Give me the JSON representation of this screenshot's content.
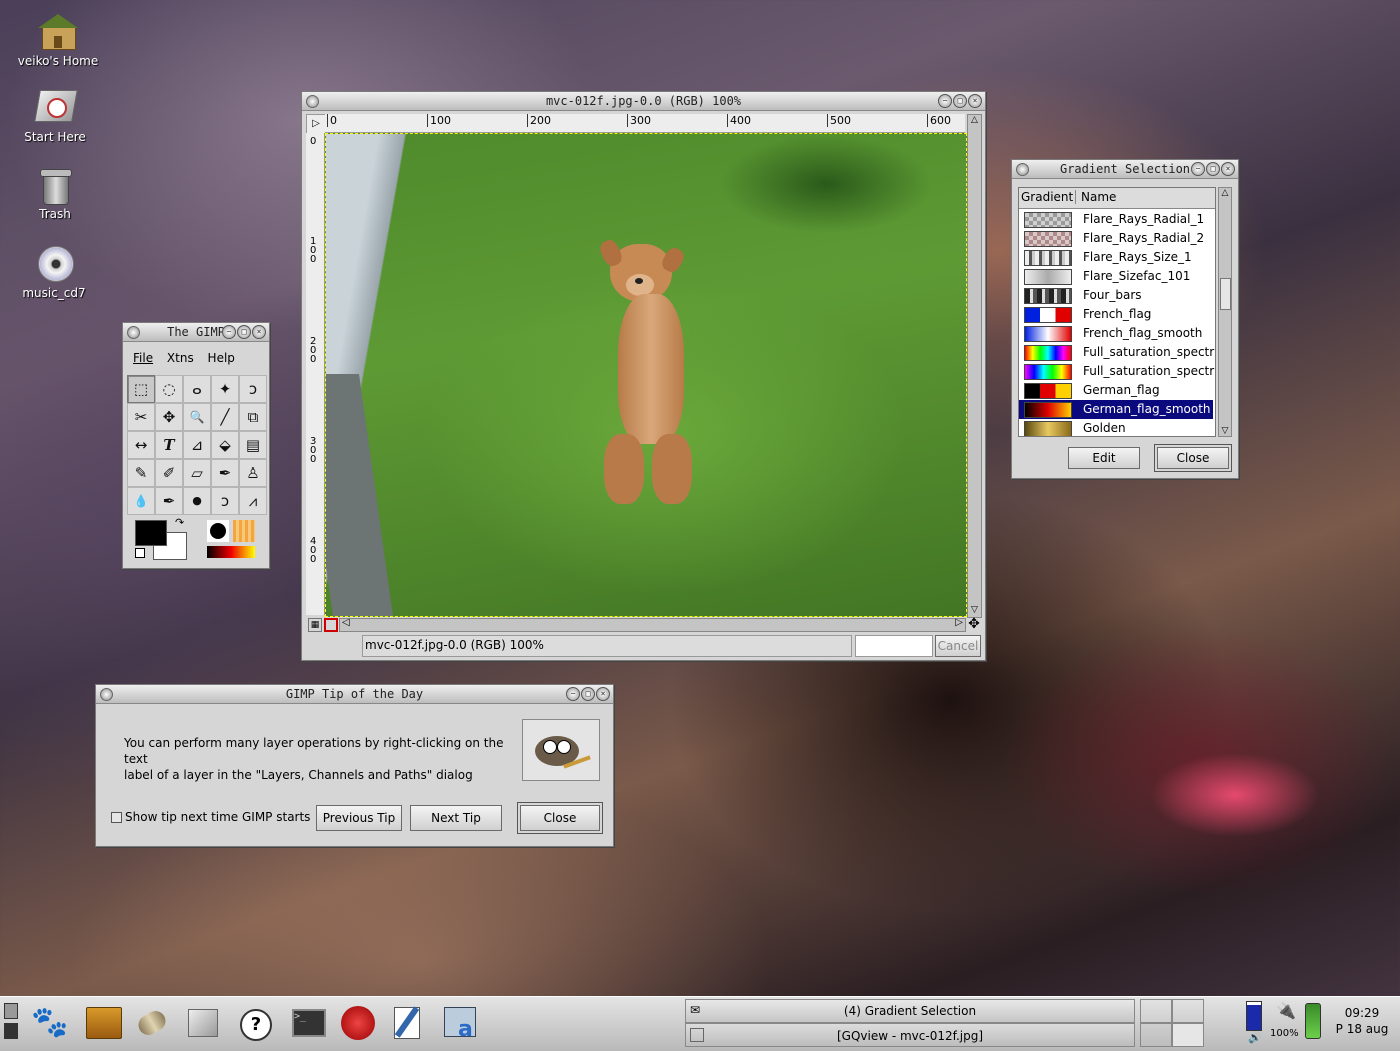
{
  "desktop": {
    "icons": [
      {
        "label": "veiko's Home",
        "icon": "home-icon"
      },
      {
        "label": "Start Here",
        "icon": "start-here-icon"
      },
      {
        "label": "Trash",
        "icon": "trash-icon"
      },
      {
        "label": "music_cd7",
        "icon": "cd-icon"
      }
    ]
  },
  "image_window": {
    "title": "mvc-012f.jpg-0.0 (RGB) 100%",
    "ruler_h": [
      "0",
      "100",
      "200",
      "300",
      "400",
      "500",
      "600"
    ],
    "ruler_v": [
      "0",
      "100",
      "200",
      "300",
      "400"
    ],
    "status": "mvc-012f.jpg-0.0 (RGB) 100%",
    "cancel_label": "Cancel"
  },
  "gimp_toolbox": {
    "title": "The GIMP",
    "menu": [
      "File",
      "Xtns",
      "Help"
    ],
    "tools": [
      "rect-select",
      "ellipse-select",
      "free-select",
      "fuzzy-select",
      "bezier-select",
      "intelligent-scissors",
      "move",
      "magnify",
      "crop",
      "transform",
      "flip",
      "text",
      "color-picker",
      "bucket-fill",
      "blend",
      "pencil",
      "paintbrush",
      "eraser",
      "airbrush",
      "clone",
      "convolve",
      "ink",
      "dodge-burn",
      "smudge",
      "measure"
    ],
    "tool_glyphs": [
      "⬚",
      "◌",
      "ⴰ",
      "✦",
      "ↄ",
      "✂",
      "✥",
      "🔍",
      "╱",
      "⧉",
      "↔",
      "T",
      "⊿",
      "⬙",
      "▤",
      "✎",
      "✐",
      "▱",
      "✒",
      "♙",
      "💧",
      "✒",
      "●",
      "ↄ",
      "⩘"
    ]
  },
  "gradient_selection": {
    "title": "Gradient Selection",
    "columns": [
      "Gradient",
      "Name"
    ],
    "items": [
      {
        "name": "Flare_Rays_Radial_1",
        "preview": "checker-grey"
      },
      {
        "name": "Flare_Rays_Radial_2",
        "preview": "checker-pink"
      },
      {
        "name": "Flare_Rays_Size_1",
        "preview": "stripes-grey"
      },
      {
        "name": "Flare_Sizefac_101",
        "preview": "grey-fade"
      },
      {
        "name": "Four_bars",
        "preview": "bars"
      },
      {
        "name": "French_flag",
        "preview": "french"
      },
      {
        "name": "French_flag_smooth",
        "preview": "french-smooth"
      },
      {
        "name": "Full_saturation_spectru",
        "preview": "spectrum"
      },
      {
        "name": "Full_saturation_spectru",
        "preview": "spectrum2"
      },
      {
        "name": "German_flag",
        "preview": "german"
      },
      {
        "name": "German_flag_smooth",
        "preview": "german-smooth"
      },
      {
        "name": "Golden",
        "preview": "golden"
      }
    ],
    "selected_index": 10,
    "edit_label": "Edit",
    "close_label": "Close"
  },
  "tip_dialog": {
    "title": "GIMP Tip of the Day",
    "tip_line1": "You can perform many layer operations by right-clicking on the text",
    "tip_line2": "label of a layer in the \"Layers, Channels and Paths\" dialog",
    "checkbox_label": "Show tip next time GIMP starts",
    "checkbox_checked": false,
    "previous_label": "Previous Tip",
    "next_label": "Next Tip",
    "close_label": "Close"
  },
  "taskbar": {
    "launchers": [
      "gnome-foot-icon",
      "drawer-icon",
      "panel-icon",
      "start-here-icon",
      "help-icon",
      "terminal-icon",
      "mozilla-icon",
      "editor-icon",
      "window-app-icon"
    ],
    "tasks": [
      "(4) Gradient Selection",
      "[GQview - mvc-012f.jpg]"
    ],
    "battery_percent": "100%",
    "clock_time": "09:29",
    "clock_date": "P 18 aug"
  },
  "colors": {
    "selection": "#0a0a7e",
    "window_bg": "#d6d6d6"
  }
}
